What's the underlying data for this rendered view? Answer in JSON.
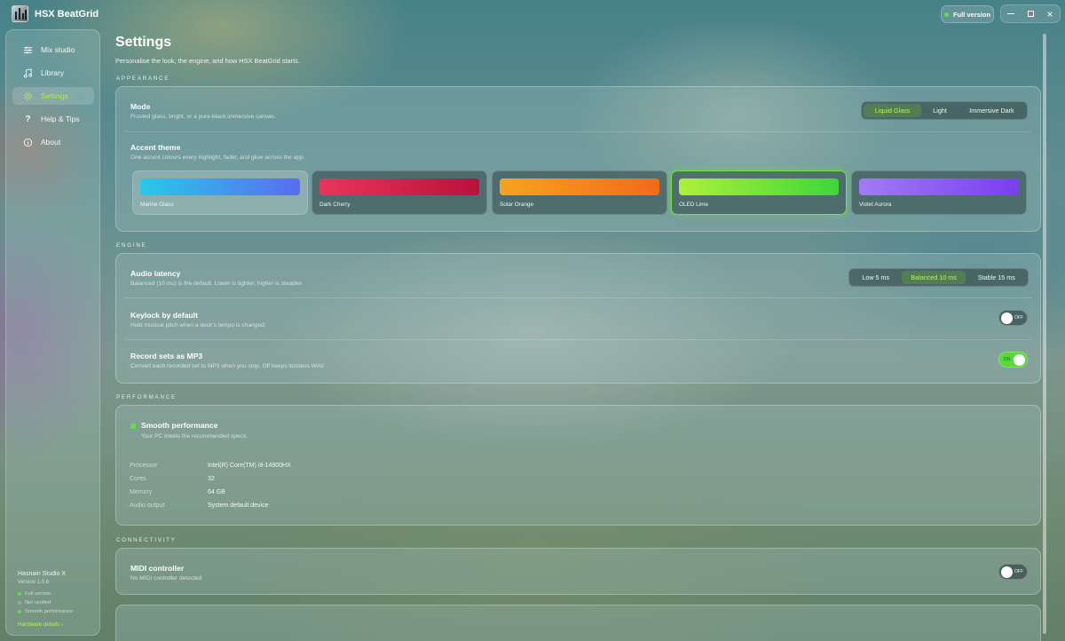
{
  "app": {
    "title": "HSX BeatGrid",
    "full_version": "Full version",
    "window_controls": [
      "minimize-icon",
      "maximize-icon",
      "close-icon"
    ]
  },
  "sidebar": {
    "items": [
      {
        "label": "Mix studio",
        "icon": "mixer-icon",
        "active": false
      },
      {
        "label": "Library",
        "icon": "music-note-icon",
        "active": false
      },
      {
        "label": "Settings",
        "icon": "gear-icon",
        "active": true
      },
      {
        "label": "Help & Tips",
        "icon": "question-icon",
        "active": false
      },
      {
        "label": "About",
        "icon": "info-icon",
        "active": false
      }
    ],
    "footer": {
      "studio": "Hasnain Studio X",
      "version": "Version 1.0.6",
      "statuses": [
        "Full version",
        "Not verified",
        "Smooth performance"
      ],
      "hardware_link": "Hardware details ›"
    }
  },
  "page": {
    "title": "Settings",
    "subtitle": "Personalise the look, the engine, and how HSX BeatGrid starts."
  },
  "appearance": {
    "label": "APPEARANCE",
    "mode": {
      "title": "Mode",
      "desc": "Frosted glass, bright, or a pure-black immersive canvas.",
      "options": [
        "Liquid Glass",
        "Light",
        "Immersive Dark"
      ],
      "selected": "Liquid Glass"
    },
    "accent": {
      "title": "Accent theme",
      "desc": "One accent colours every highlight, fader, and glow across the app.",
      "themes": [
        {
          "name": "Marine Glass",
          "from": "#27c9ea",
          "to": "#5a6cf0"
        },
        {
          "name": "Dark Cherry",
          "from": "#e8355c",
          "to": "#b8123c"
        },
        {
          "name": "Solar Orange",
          "from": "#f6a31e",
          "to": "#f26a1c"
        },
        {
          "name": "OLED Lime",
          "from": "#aef03a",
          "to": "#3ed63a"
        },
        {
          "name": "Violet Aurora",
          "from": "#a17bf4",
          "to": "#7a3ef0"
        }
      ],
      "selected": "OLED Lime"
    }
  },
  "engine": {
    "label": "ENGINE",
    "latency": {
      "title": "Audio latency",
      "desc": "Balanced (10 ms) is the default. Lower is tighter; higher is steadier.",
      "options": [
        "Low 5 ms",
        "Balanced 10 ms",
        "Stable 15 ms"
      ],
      "selected": "Balanced 10 ms"
    },
    "keylock": {
      "title": "Keylock by default",
      "desc": "Hold musical pitch when a deck's tempo is changed.",
      "state": "OFF"
    },
    "mp3": {
      "title": "Record sets as MP3",
      "desc": "Convert each recorded set to MP3 when you stop. Off keeps lossless WAV.",
      "state": "ON"
    }
  },
  "performance": {
    "label": "PERFORMANCE",
    "status_title": "Smooth performance",
    "status_desc": "Your PC meets the recommended specs.",
    "specs": [
      {
        "label": "Processor",
        "value": "Intel(R) Core(TM) i9-14900HX"
      },
      {
        "label": "Cores",
        "value": "32"
      },
      {
        "label": "Memory",
        "value": "64 GB"
      },
      {
        "label": "Audio output",
        "value": "System default device"
      }
    ]
  },
  "connectivity": {
    "label": "CONNECTIVITY",
    "midi": {
      "title": "MIDI controller",
      "desc": "No MIDI controller detected",
      "state": "OFF"
    }
  },
  "colors": {
    "accent": "#a7f04c",
    "status_green": "#59e04a"
  }
}
